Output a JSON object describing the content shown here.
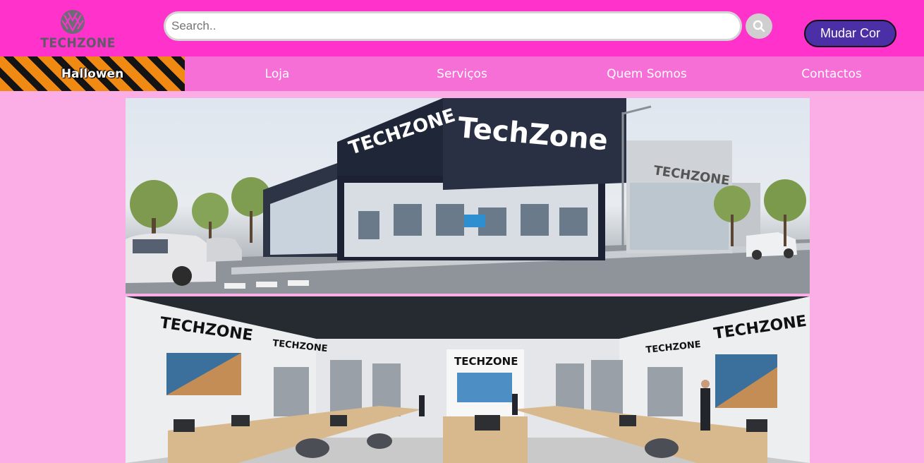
{
  "header": {
    "logo_text": "TECHZONE",
    "search_placeholder": "Search..",
    "search_icon": "magnifier-icon",
    "mudar_cor_label": "Mudar Cor"
  },
  "nav": {
    "items": [
      {
        "label": "Hallowen"
      },
      {
        "label": "Loja"
      },
      {
        "label": "Serviços"
      },
      {
        "label": "Quem Somos"
      },
      {
        "label": "Contactos"
      }
    ]
  },
  "content": {
    "banner_exterior": {
      "sign_1": "TECHZONE",
      "sign_2": "TechZone",
      "sign_3": "TECHZONE"
    },
    "banner_interior": {
      "sign_left": "TECHZONE",
      "sign_center": "TECHZONE",
      "sign_right": "TECHZONE",
      "sign_small_left": "TECHZONE",
      "sign_small_right": "TECHZONE"
    }
  },
  "colors": {
    "header_bg": "#ff33cc",
    "nav_bg": "#f56fd6",
    "page_bg": "#fbaee6",
    "button_bg": "#4b2fa6",
    "halloween_orange": "#f08a12",
    "halloween_black": "#141414"
  }
}
